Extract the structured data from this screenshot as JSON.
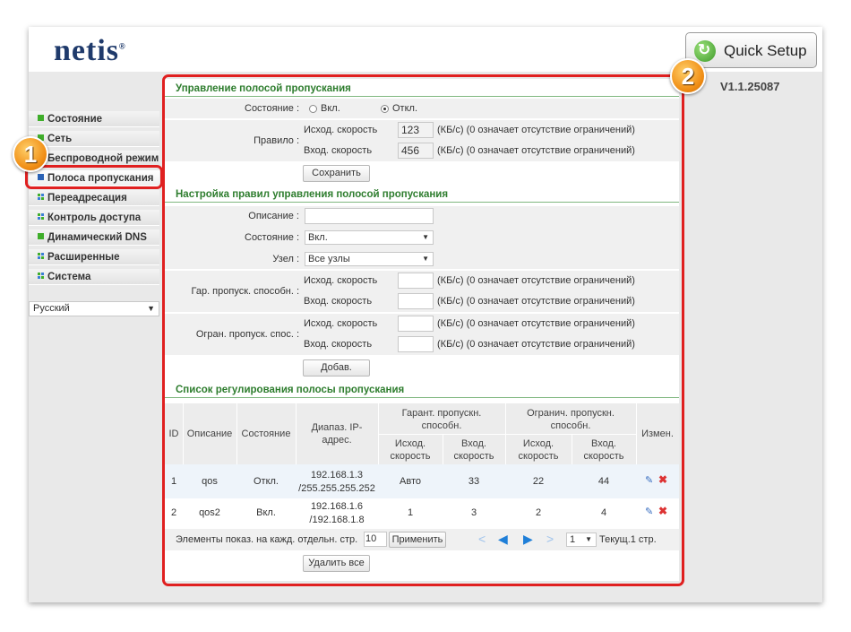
{
  "header": {
    "logo": "netis",
    "logo_mark": "®",
    "quick_setup": "Quick Setup",
    "version": "V1.1.25087"
  },
  "sidebar": {
    "items": [
      {
        "label": "Состояние"
      },
      {
        "label": "Сеть"
      },
      {
        "label": "Беспроводной режим"
      },
      {
        "label": "Полоса пропускания"
      },
      {
        "label": "Переадресация"
      },
      {
        "label": "Контроль доступа"
      },
      {
        "label": "Динамический DNS"
      },
      {
        "label": "Расширенные"
      },
      {
        "label": "Система"
      }
    ],
    "language": "Русский"
  },
  "bandwidth": {
    "title": "Управление полосой пропускания",
    "state_label": "Состояние :",
    "opt_on": "Вкл.",
    "opt_off": "Откл.",
    "rule_label": "Правило :",
    "up_label": "Исход. скорость",
    "down_label": "Вход. скорость",
    "up_value": "123",
    "down_value": "456",
    "unit_hint": "(КБ/с) (0 означает отсутствие ограничений)",
    "save": "Сохранить"
  },
  "rules": {
    "title": "Настройка правил управления полосой пропускания",
    "desc_label": "Описание :",
    "state_label": "Состояние :",
    "state_value": "Вкл.",
    "node_label": "Узел :",
    "node_value": "Все узлы",
    "guar_label": "Гар. пропуск. способн. :",
    "limit_label": "Огран. пропуск. спос. :",
    "up_label": "Исход. скорость",
    "down_label": "Вход. скорость",
    "unit_hint": "(КБ/с) (0 означает отсутствие ограничений)",
    "add": "Добав."
  },
  "list": {
    "title": "Список регулирования полосы пропускания",
    "headers": {
      "id": "ID",
      "desc": "Описание",
      "state": "Состояние",
      "range": "Диапаз. IP-адрес.",
      "guar": "Гарант. пропускн. способн.",
      "limit": "Огранич. пропускн. способн.",
      "up": "Исход. скорость",
      "down": "Вход. скорость",
      "edit": "Измен."
    },
    "rows": [
      {
        "id": "1",
        "desc": "qos",
        "state": "Откл.",
        "ip1": "192.168.1.3",
        "ip2": "/255.255.255.252",
        "g_up": "Авто",
        "g_down": "33",
        "l_up": "22",
        "l_down": "44"
      },
      {
        "id": "2",
        "desc": "qos2",
        "state": "Вкл.",
        "ip1": "192.168.1.6",
        "ip2": "/192.168.1.8",
        "g_up": "1",
        "g_down": "3",
        "l_up": "2",
        "l_down": "4"
      }
    ],
    "per_page_label": "Элементы показ. на кажд. отдельн. стр.",
    "per_page_value": "10",
    "apply": "Применить",
    "page_value": "1",
    "page_info": "Текущ.1 стр.",
    "delete_all": "Удалить все"
  },
  "callouts": {
    "one": "1",
    "two": "2"
  },
  "colors": {
    "accent_red": "#e02020",
    "section_green": "#2e7d2e",
    "logo_blue": "#1f3a6b",
    "badge_orange": "#f08d14"
  }
}
